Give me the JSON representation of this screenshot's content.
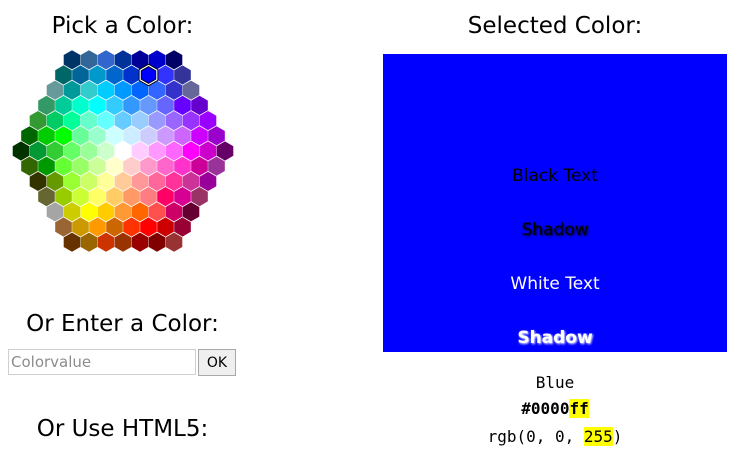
{
  "picker": {
    "title": "Pick a Color:"
  },
  "enter": {
    "title": "Or Enter a Color:",
    "placeholder": "Colorvalue",
    "ok_label": "OK"
  },
  "html5": {
    "title": "Or Use HTML5:"
  },
  "selected": {
    "title": "Selected Color:",
    "color": "#0000ff",
    "texts": {
      "black_text": "Black Text",
      "black_shadow": "Shadow",
      "white_text": "White Text",
      "white_shadow": "Shadow"
    },
    "name": "Blue",
    "hex_prefix": "#0000",
    "hex_suffix": "ff",
    "rgb_prefix": "rgb(0, 0, ",
    "rgb_blue": "255",
    "rgb_suffix": ")"
  },
  "hex_rows": [
    [
      "#003366",
      "#336699",
      "#3366cc",
      "#003399",
      "#000099",
      "#0000cc",
      "#000066"
    ],
    [
      "#006666",
      "#006699",
      "#0099cc",
      "#0066cc",
      "#0033cc",
      "#0000ff",
      "#3333ff",
      "#333399"
    ],
    [
      "#669999",
      "#009999",
      "#33cccc",
      "#00ccff",
      "#0099ff",
      "#0066ff",
      "#3366ff",
      "#3333cc",
      "#666699"
    ],
    [
      "#339966",
      "#00cc99",
      "#00ffcc",
      "#00ffff",
      "#33ccff",
      "#3399ff",
      "#6699ff",
      "#6666ff",
      "#6600ff",
      "#6600cc"
    ],
    [
      "#339933",
      "#00cc66",
      "#00ff99",
      "#66ffcc",
      "#66ffff",
      "#66ccff",
      "#99ccff",
      "#9999ff",
      "#9966ff",
      "#9933ff",
      "#9900ff"
    ],
    [
      "#006600",
      "#00cc00",
      "#00ff00",
      "#66ff99",
      "#99ffcc",
      "#ccffff",
      "#ccecff",
      "#ccccff",
      "#cc99ff",
      "#cc66ff",
      "#cc00ff",
      "#9900cc"
    ],
    [
      "#003300",
      "#009933",
      "#33cc33",
      "#66ff66",
      "#99ff99",
      "#ccffcc",
      "#ffffff",
      "#ffccff",
      "#ff99ff",
      "#ff66ff",
      "#ff00ff",
      "#cc00cc",
      "#660066"
    ],
    [
      "#336600",
      "#009900",
      "#66ff33",
      "#99ff66",
      "#ccff99",
      "#ffffcc",
      "#ffcccc",
      "#ff99cc",
      "#ff66cc",
      "#ff33cc",
      "#cc0099",
      "#993399"
    ],
    [
      "#333300",
      "#669900",
      "#99ff33",
      "#ccff66",
      "#ffff99",
      "#ffcc99",
      "#ff9999",
      "#ff6699",
      "#ff3399",
      "#cc3399",
      "#990099"
    ],
    [
      "#666633",
      "#99cc00",
      "#ccff33",
      "#ffff66",
      "#ffcc66",
      "#ff9966",
      "#ff7c80",
      "#ff0066",
      "#d60093",
      "#993366"
    ],
    [
      "#a5a5a5",
      "#cccc00",
      "#ffff00",
      "#ffcc00",
      "#ff9933",
      "#ff6600",
      "#ff5050",
      "#cc0066",
      "#660033"
    ],
    [
      "#996633",
      "#cc9900",
      "#ff9900",
      "#cc6600",
      "#ff3300",
      "#ff0000",
      "#cc0000",
      "#990033"
    ],
    [
      "#663300",
      "#996600",
      "#cc3300",
      "#993300",
      "#990000",
      "#800000",
      "#993333"
    ]
  ],
  "selected_cell": [
    1,
    5
  ]
}
